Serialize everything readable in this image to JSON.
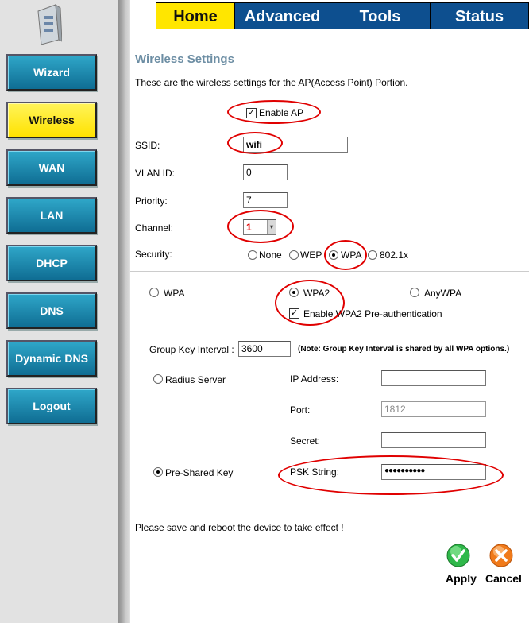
{
  "tabs": [
    {
      "label": "Home"
    },
    {
      "label": "Advanced"
    },
    {
      "label": "Tools"
    },
    {
      "label": "Status"
    }
  ],
  "sidebar": {
    "items": [
      {
        "label": "Wizard"
      },
      {
        "label": "Wireless"
      },
      {
        "label": "WAN"
      },
      {
        "label": "LAN"
      },
      {
        "label": "DHCP"
      },
      {
        "label": "DNS"
      },
      {
        "label": "Dynamic DNS"
      },
      {
        "label": "Logout"
      }
    ]
  },
  "page": {
    "title": "Wireless Settings",
    "intro": "These are the wireless settings for the AP(Access Point) Portion.",
    "enable_ap": "Enable AP",
    "ssid_label": "SSID:",
    "ssid_value": "wifi",
    "vlan_label": "VLAN ID:",
    "vlan_value": "0",
    "priority_label": "Priority:",
    "priority_value": "7",
    "channel_label": "Channel:",
    "channel_value": "1",
    "security_label": "Security:",
    "security_options": [
      "None",
      "WEP",
      "WPA",
      "802.1x"
    ],
    "wpa_modes": [
      "WPA",
      "WPA2",
      "AnyWPA"
    ],
    "preauth": "Enable WPA2 Pre-authentication",
    "group_key_label": "Group Key Interval :",
    "group_key_value": "3600",
    "group_key_note": "(Note: Group Key Interval is shared by all WPA options.)",
    "radius_label": "Radius Server",
    "ip_label": "IP Address:",
    "port_label": "Port:",
    "port_value": "1812",
    "secret_label": "Secret:",
    "psk_label": "Pre-Shared Key",
    "psk_string_label": "PSK String:",
    "psk_value": "●●●●●●●●●●",
    "save_note": "Please save and reboot the device to take effect !",
    "apply": "Apply",
    "cancel": "Cancel"
  },
  "colors": {
    "accent": "#ffe600",
    "tab_blue": "#0d4f8f",
    "annotation": "#e00000"
  }
}
